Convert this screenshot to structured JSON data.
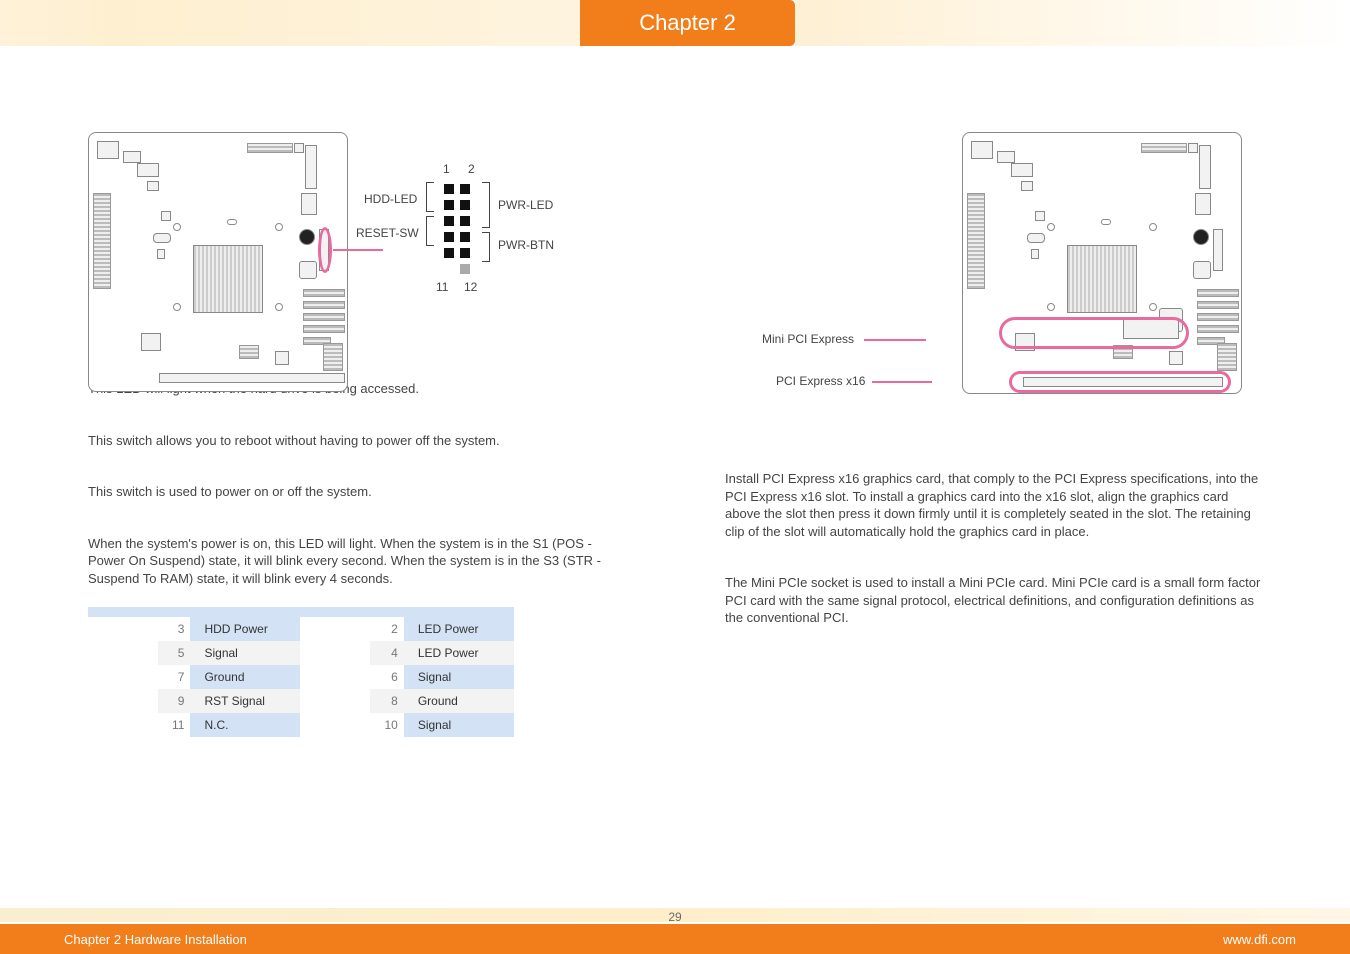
{
  "header": {
    "chapter_label": "Chapter 2"
  },
  "left": {
    "conn_diagram": {
      "top_left_num": "1",
      "top_right_num": "2",
      "bottom_left_num": "11",
      "bottom_right_num": "12",
      "hdd_led": "HDD-LED",
      "reset_sw": "RESET-SW",
      "pwr_led": "PWR-LED",
      "pwr_btn": "PWR-BTN"
    },
    "sections": {
      "hdd_led_text": "This LED will light when the hard drive is being accessed.",
      "reset_sw_text": "This switch allows you to reboot without having to power off the system.",
      "pwr_btn_text": "This switch is used to power on or off the system.",
      "pwr_led_text": "When the system's power is on, this LED will light. When the system is in the S1 (POS - Power On Suspend) state, it will blink every second. When the system is in the S3 (STR - Suspend To RAM) state, it will blink every 4 seconds."
    },
    "pin_table": {
      "rows": [
        {
          "p1": "3",
          "f1": "HDD Power",
          "p2": "2",
          "f2": "LED Power"
        },
        {
          "p1": "5",
          "f1": "Signal",
          "p2": "4",
          "f2": "LED Power"
        },
        {
          "p1": "7",
          "f1": "Ground",
          "p2": "6",
          "f2": "Signal"
        },
        {
          "p1": "9",
          "f1": "RST Signal",
          "p2": "8",
          "f2": "Ground"
        },
        {
          "p1": "11",
          "f1": "N.C.",
          "p2": "10",
          "f2": "Signal"
        }
      ]
    }
  },
  "right": {
    "labels": {
      "mini_pcie": "Mini PCI Express",
      "pcie_x16": "PCI Express x16"
    },
    "pcie_text": "Install PCI Express x16 graphics card, that comply to the PCI Express specifications, into the PCI Express x16 slot. To install a graphics card into the x16 slot, align the graphics card above the slot then press it down firmly until it is completely seated in the slot. The retaining clip of the slot will automatically hold the graphics card in place.",
    "mini_pcie_text": "The Mini PCIe socket is used to install a Mini PCIe card. Mini PCIe card is a small form factor PCI card with the same signal protocol, electrical definitions, and configuration definitions as the conventional PCI."
  },
  "footer": {
    "page": "29",
    "left_text": "Chapter 2 Hardware Installation",
    "right_text": "www.dfi.com"
  }
}
